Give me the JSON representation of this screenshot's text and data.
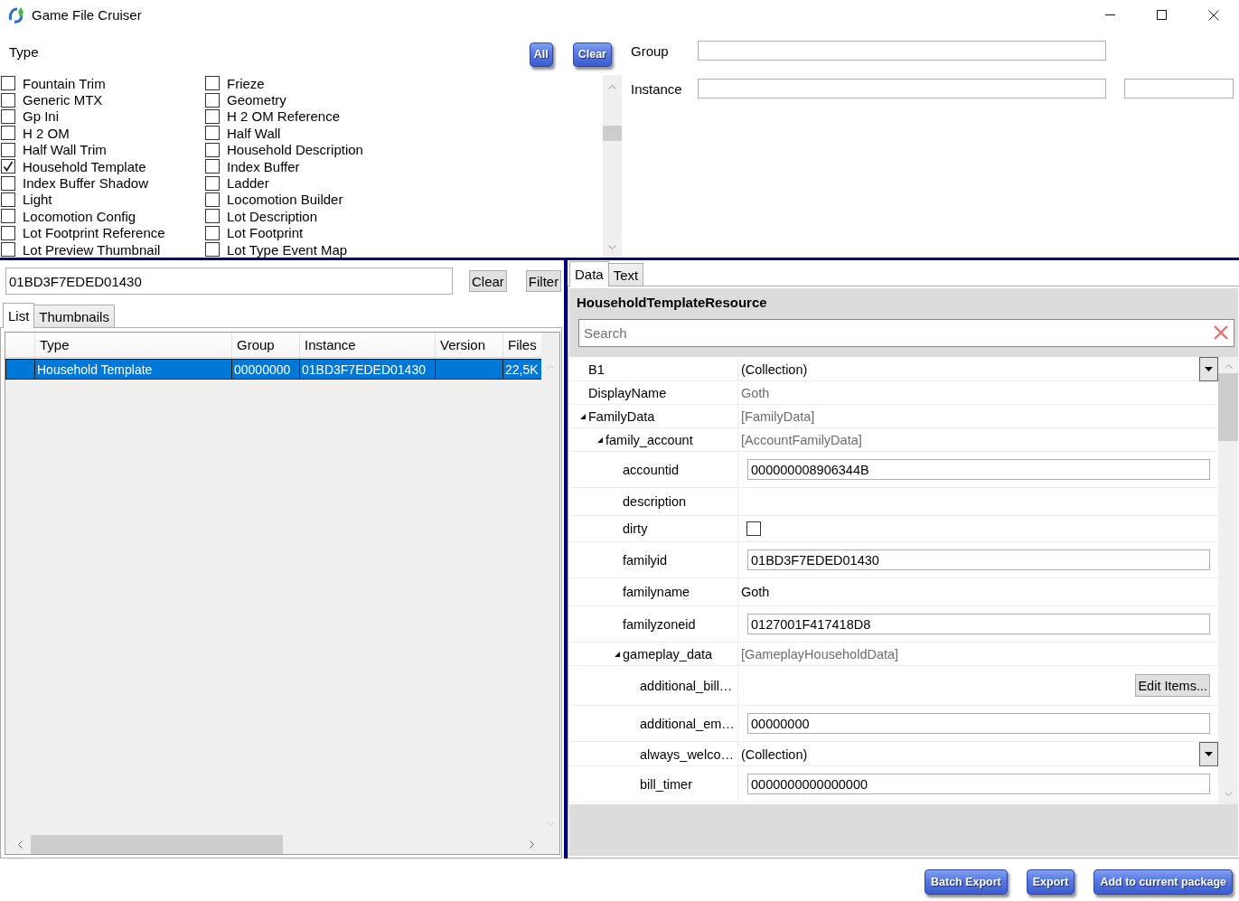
{
  "window": {
    "title": "Game File Cruiser"
  },
  "type_filter": {
    "label": "Type",
    "buttons": [
      "All",
      "Clear"
    ],
    "items": [
      {
        "label": "Fountain Trim",
        "checked": false
      },
      {
        "label": "Frieze",
        "checked": false
      },
      {
        "label": "Generic MTX",
        "checked": false
      },
      {
        "label": "Geometry",
        "checked": false
      },
      {
        "label": "Gp Ini",
        "checked": false
      },
      {
        "label": "H 2 OM Reference",
        "checked": false
      },
      {
        "label": "H 2 OM",
        "checked": false
      },
      {
        "label": "Half Wall",
        "checked": false
      },
      {
        "label": "Half Wall Trim",
        "checked": false
      },
      {
        "label": "Household Description",
        "checked": false
      },
      {
        "label": "Household Template",
        "checked": true
      },
      {
        "label": "Index Buffer",
        "checked": false
      },
      {
        "label": "Index Buffer Shadow",
        "checked": false
      },
      {
        "label": "Ladder",
        "checked": false
      },
      {
        "label": "Light",
        "checked": false
      },
      {
        "label": "Locomotion Builder",
        "checked": false
      },
      {
        "label": "Locomotion Config",
        "checked": false
      },
      {
        "label": "Lot Description",
        "checked": false
      },
      {
        "label": "Lot Footprint Reference",
        "checked": false
      },
      {
        "label": "Lot Footprint",
        "checked": false
      },
      {
        "label": "Lot Preview Thumbnail",
        "checked": false
      },
      {
        "label": "Lot Type Event Map",
        "checked": false
      }
    ]
  },
  "id_fields": {
    "group": {
      "label": "Group"
    },
    "instance": {
      "label": "Instance"
    }
  },
  "file_list": {
    "filter": {
      "value": "01BD3F7EDED01430"
    },
    "buttons": [
      "Clear",
      "Filter"
    ],
    "tabs": [
      {
        "label": "List",
        "selected": true
      },
      {
        "label": "Thumbnails",
        "selected": false
      }
    ],
    "columns": [
      "Type",
      "Group",
      "Instance",
      "Version",
      "Files"
    ],
    "rows": [
      {
        "selected": true,
        "cells": [
          "Household Template",
          "00000000",
          "01BD3F7EDED01430",
          null,
          "22,5K"
        ]
      }
    ]
  },
  "property_panel": {
    "tabs": [
      {
        "label": "Data",
        "selected": true
      },
      {
        "label": "Text",
        "selected": false
      }
    ],
    "title": "HouseholdTemplateResource",
    "search": {
      "placeholder": "Search"
    },
    "properties": [
      {
        "name": "B1",
        "kind": "dropdown",
        "value": "(Collection)"
      },
      {
        "name": "DisplayName",
        "kind": "readonly",
        "value": "Goth"
      },
      {
        "name": "FamilyData",
        "kind": "group",
        "value": "[FamilyData]",
        "expanded": true,
        "children": [
          {
            "name": "family_account",
            "kind": "group",
            "value": "[AccountFamilyData]",
            "expanded": true,
            "children": [
              {
                "name": "accountid",
                "kind": "input",
                "value": "000000008906344B"
              },
              {
                "name": "description",
                "kind": "text"
              },
              {
                "name": "dirty",
                "kind": "checkbox",
                "checked": false
              },
              {
                "name": "familyid",
                "kind": "input",
                "value": "01BD3F7EDED01430"
              },
              {
                "name": "familyname",
                "kind": "text",
                "value": "Goth"
              },
              {
                "name": "familyzoneid",
                "kind": "input",
                "value": "0127001F417418D8"
              },
              {
                "name": "gameplay_data",
                "kind": "group",
                "value": "[GameplayHouseholdData]",
                "expanded": true,
                "children": [
                  {
                    "name": "additional_bill…",
                    "kind": "button",
                    "value": "Edit Items..."
                  },
                  {
                    "name": "additional_em…",
                    "kind": "input",
                    "value": "00000000"
                  },
                  {
                    "name": "always_welco…",
                    "kind": "dropdown",
                    "value": "(Collection)"
                  },
                  {
                    "name": "bill_timer",
                    "kind": "input",
                    "value": "0000000000000000"
                  }
                ]
              }
            ]
          }
        ]
      }
    ]
  },
  "footer": {
    "buttons": [
      "Batch Export",
      "Export",
      "Add to current package"
    ]
  }
}
